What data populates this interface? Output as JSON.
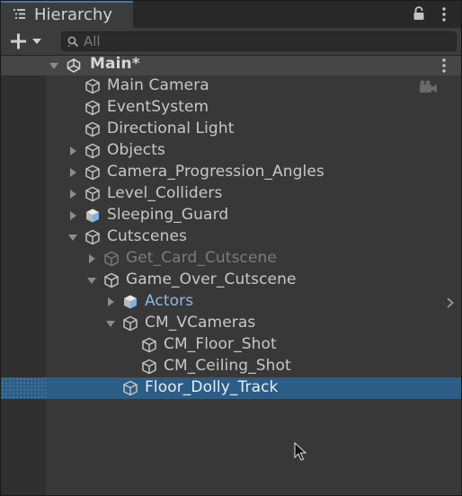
{
  "window": {
    "tab_label": "Hierarchy"
  },
  "toolbar": {
    "search_placeholder": "All"
  },
  "scene": {
    "label": "Main*"
  },
  "tree": {
    "items": [
      {
        "label": "Main Camera"
      },
      {
        "label": "EventSystem"
      },
      {
        "label": "Directional Light"
      },
      {
        "label": "Objects"
      },
      {
        "label": "Camera_Progression_Angles"
      },
      {
        "label": "Level_Colliders"
      },
      {
        "label": "Sleeping_Guard"
      },
      {
        "label": "Cutscenes"
      },
      {
        "label": "Get_Card_Cutscene"
      },
      {
        "label": "Game_Over_Cutscene"
      },
      {
        "label": "Actors"
      },
      {
        "label": "CM_VCameras"
      },
      {
        "label": "CM_Floor_Shot"
      },
      {
        "label": "CM_Ceiling_Shot"
      },
      {
        "label": "Floor_Dolly_Track"
      }
    ]
  },
  "colors": {
    "panel_background": "#383838",
    "selection": "#2c5d87",
    "tab_accent": "#3a79bb",
    "prefab_text": "#8fb6e6",
    "disabled_text": "#7c7c7c"
  },
  "icons": {
    "tab": "hierarchy-list-icon",
    "lock": "lock-icon",
    "menu": "kebab-menu-icon",
    "add": "plus-dropdown-icon",
    "search": "search-icon",
    "unity": "unity-logo-icon",
    "gameobject": "cube-outline-icon",
    "prefab": "cube-filled-icon",
    "camera": "camera-gizmo-icon"
  }
}
